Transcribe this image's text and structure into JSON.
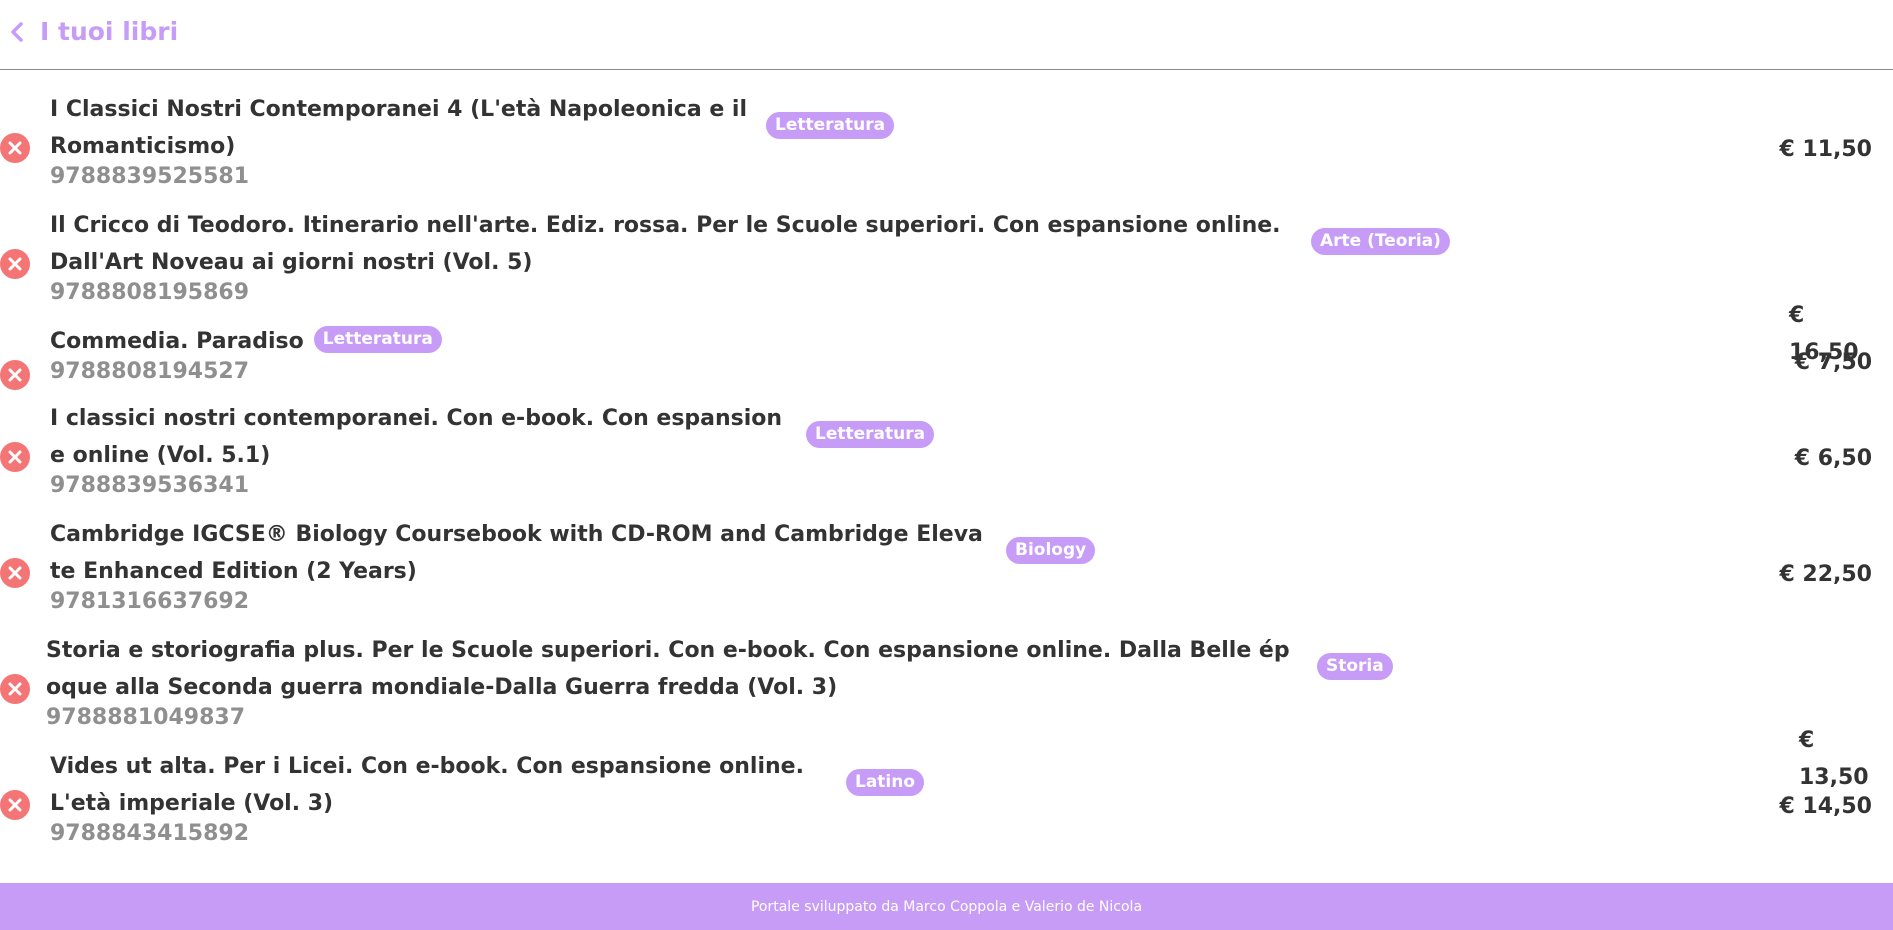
{
  "header": {
    "title": "I tuoi libri",
    "back_icon": "chevron-left-icon"
  },
  "colors": {
    "accent": "#c79cf6",
    "remove": "#f47575",
    "text": "#333333",
    "isbn": "#8f8f8f"
  },
  "books": [
    {
      "title": "I Classici Nostri Contemporanei 4 (L'età Napoleonica e il Romanticismo)",
      "isbn": "9788839525581",
      "subject": "Letteratura",
      "price": "€ 11,50"
    },
    {
      "title": "Il Cricco di Teodoro. Itinerario nell'arte. Ediz. rossa. Per le Scuole superiori. Con espansione online. Dall'Art Noveau ai giorni nostri (Vol. 5)",
      "isbn": "9788808195869",
      "subject": "Arte (Teoria)",
      "price": "€ 16,50"
    },
    {
      "title": "Commedia. Paradiso",
      "isbn": "9788808194527",
      "subject": "Letteratura",
      "price": "€ 7,50"
    },
    {
      "title": "I classici nostri contemporanei. Con e-book. Con espansione online (Vol. 5.1)",
      "isbn": "9788839536341",
      "subject": "Letteratura",
      "price": "€ 6,50"
    },
    {
      "title": "Cambridge IGCSE® Biology Coursebook with CD-ROM and Cambridge Elevate Enhanced Edition (2 Years)",
      "isbn": "9781316637692",
      "subject": "Biology",
      "price": "€ 22,50"
    },
    {
      "title": "Storia e storiografia plus. Per le Scuole superiori. Con e-book. Con espansione online. Dalla Belle époque alla Seconda guerra mondiale-Dalla Guerra fredda (Vol. 3)",
      "isbn": "9788881049837",
      "subject": "Storia",
      "price": "€ 13,50"
    },
    {
      "title": "Vides ut alta. Per i Licei. Con e-book. Con espansione online. L'età imperiale (Vol. 3)",
      "isbn": "9788843415892",
      "subject": "Latino",
      "price": "€ 14,50"
    }
  ],
  "footer": {
    "text": "Portale sviluppato da Marco Coppola e Valerio de Nicola"
  }
}
